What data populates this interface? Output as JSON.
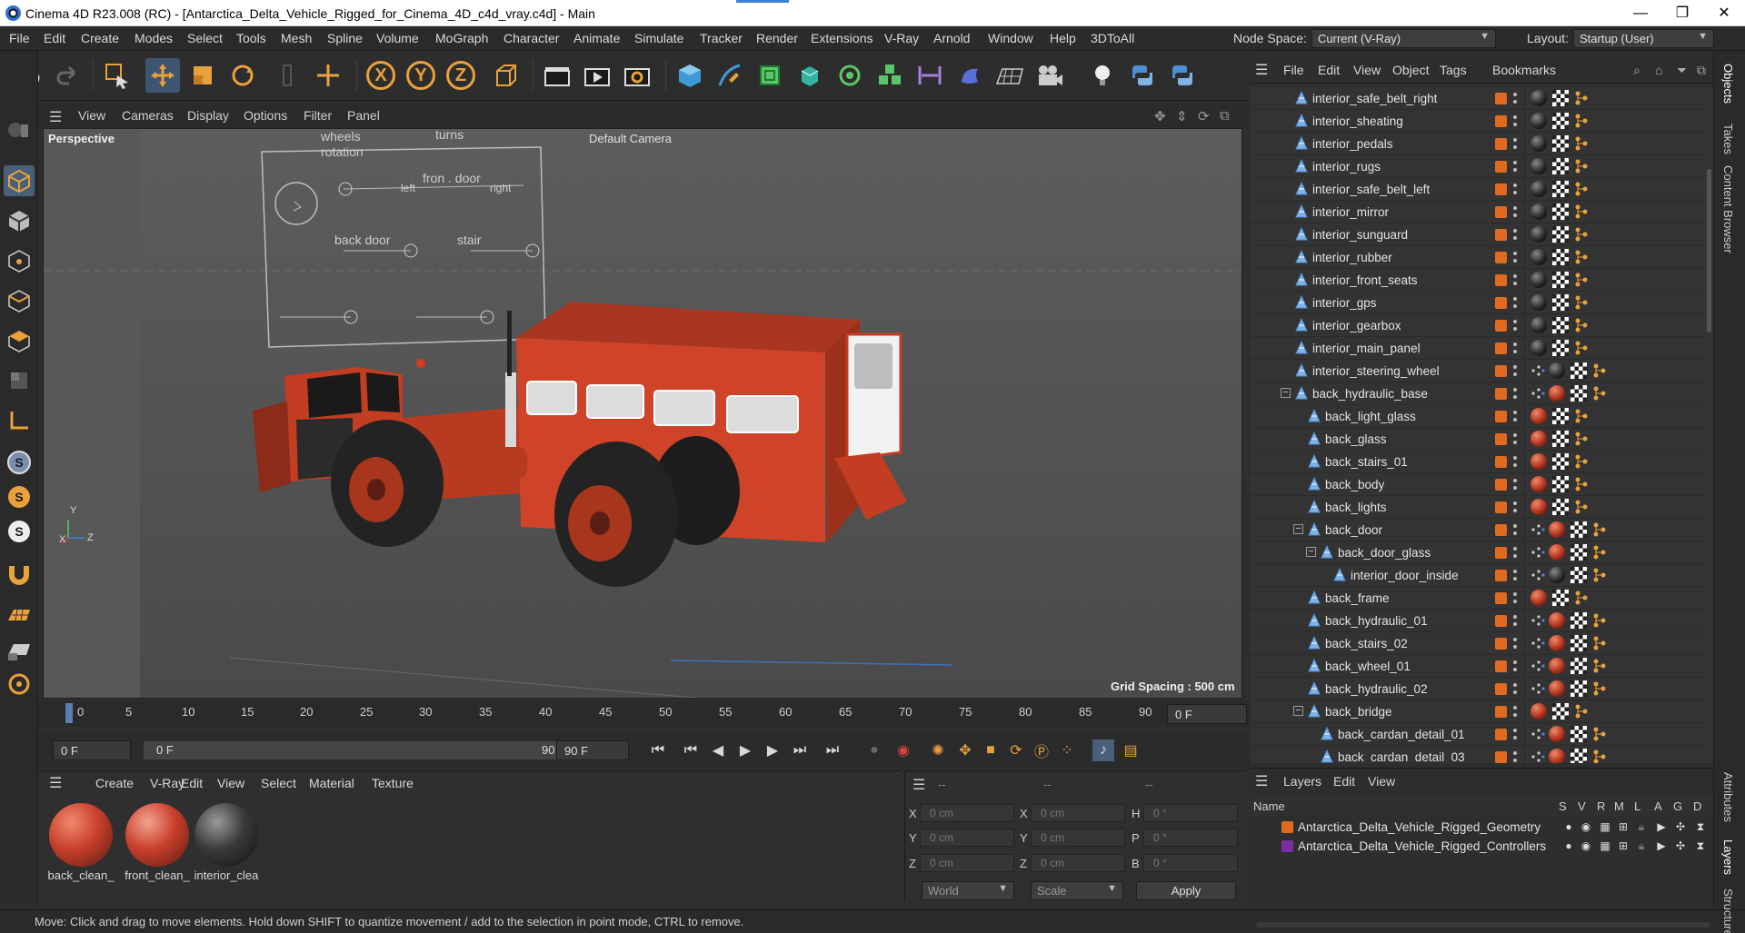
{
  "titlebar": {
    "title": "Cinema 4D R23.008 (RC) - [Antarctica_Delta_Vehicle_Rigged_for_Cinema_4D_c4d_vray.c4d] - Main",
    "minimize": "—",
    "maximize": "❐",
    "close": "✕"
  },
  "menu": {
    "items": [
      "File",
      "Edit",
      "Create",
      "Modes",
      "Select",
      "Tools",
      "Mesh",
      "Spline",
      "Volume",
      "MoGraph",
      "Character",
      "Animate",
      "Simulate",
      "Tracker",
      "Render",
      "Extensions",
      "V-Ray",
      "Arnold",
      "Window",
      "Help",
      "3DToAll"
    ],
    "node_space_label": "Node Space:",
    "node_space_value": "Current (V-Ray)",
    "layout_label": "Layout:",
    "layout_value": "Startup (User)"
  },
  "viewport": {
    "menu": [
      "View",
      "Cameras",
      "Display",
      "Options",
      "Filter",
      "Panel"
    ],
    "label": "Perspective",
    "camera": "Default Camera",
    "grid_spacing": "Grid Spacing : 500 cm",
    "control_panel": {
      "wheels_rotation": "wheels\nrotation",
      "turns": "turns",
      "front_door": "fron . door",
      "left": "left",
      "right": "right",
      "back_door": "back door",
      "stair": "stair"
    },
    "axis_x": "X",
    "axis_y": "Y",
    "axis_z": "Z"
  },
  "timeline": {
    "ticks": [
      "0",
      "5",
      "10",
      "15",
      "20",
      "25",
      "30",
      "35",
      "40",
      "45",
      "50",
      "55",
      "60",
      "65",
      "70",
      "75",
      "80",
      "85",
      "90"
    ],
    "current_frame": "0 F"
  },
  "transport": {
    "start_field": "0 F",
    "range_start": "0 F",
    "range_end": "90 F",
    "end_field": "90 F"
  },
  "materials": {
    "menu": [
      "Create",
      "V-Ray",
      "Edit",
      "View",
      "Select",
      "Material",
      "Texture"
    ],
    "items": [
      {
        "label": "back_clean_",
        "color": "#c9402c"
      },
      {
        "label": "front_clean_",
        "color": "#c9402c"
      },
      {
        "label": "interior_clea",
        "color": "#3a3a3a"
      }
    ]
  },
  "coords": {
    "header": [
      "--",
      "--",
      "--"
    ],
    "rows": [
      {
        "a": "X",
        "av": "0 cm",
        "b": "X",
        "bv": "0 cm",
        "c": "H",
        "cv": "0 °"
      },
      {
        "a": "Y",
        "av": "0 cm",
        "b": "Y",
        "bv": "0 cm",
        "c": "P",
        "cv": "0 °"
      },
      {
        "a": "Z",
        "av": "0 cm",
        "b": "Z",
        "bv": "0 cm",
        "c": "B",
        "cv": "0 °"
      }
    ],
    "mode1": "World",
    "mode2": "Scale",
    "apply": "Apply"
  },
  "status": "Move: Click and drag to move elements. Hold down SHIFT to quantize movement / add to the selection in point mode, CTRL to remove.",
  "objects": {
    "menu": [
      "File",
      "Edit",
      "View",
      "Object",
      "Tags",
      "Bookmarks"
    ],
    "rows": [
      {
        "name": "interior_safe_belt_right",
        "level": 1
      },
      {
        "name": "interior_sheating",
        "level": 1
      },
      {
        "name": "interior_pedals",
        "level": 1
      },
      {
        "name": "interior_rugs",
        "level": 1
      },
      {
        "name": "interior_safe_belt_left",
        "level": 1
      },
      {
        "name": "interior_mirror",
        "level": 1
      },
      {
        "name": "interior_sunguard",
        "level": 1
      },
      {
        "name": "interior_rubber",
        "level": 1
      },
      {
        "name": "interior_front_seats",
        "level": 1
      },
      {
        "name": "interior_gps",
        "level": 1
      },
      {
        "name": "interior_gearbox",
        "level": 1
      },
      {
        "name": "interior_main_panel",
        "level": 1
      },
      {
        "name": "interior_steering_wheel",
        "level": 1
      },
      {
        "name": "back_hydraulic_base",
        "level": 1
      },
      {
        "name": "back_light_glass",
        "level": 2
      },
      {
        "name": "back_glass",
        "level": 2
      },
      {
        "name": "back_stairs_01",
        "level": 2
      },
      {
        "name": "back_body",
        "level": 2
      },
      {
        "name": "back_lights",
        "level": 2
      },
      {
        "name": "back_door",
        "level": 2
      },
      {
        "name": "back_door_glass",
        "level": 3
      },
      {
        "name": "interior_door_inside",
        "level": 4
      },
      {
        "name": "back_frame",
        "level": 2
      },
      {
        "name": "back_hydraulic_01",
        "level": 2
      },
      {
        "name": "back_stairs_02",
        "level": 2
      },
      {
        "name": "back_wheel_01",
        "level": 2
      },
      {
        "name": "back_hydraulic_02",
        "level": 2
      },
      {
        "name": "back_bridge",
        "level": 2
      },
      {
        "name": "back_cardan_detail_01",
        "level": 3
      },
      {
        "name": "back_cardan_detail_03",
        "level": 3
      }
    ]
  },
  "layers": {
    "menu": [
      "Layers",
      "Edit",
      "View"
    ],
    "columns": [
      "Name",
      "S",
      "V",
      "R",
      "M",
      "L",
      "A",
      "G",
      "D"
    ],
    "rows": [
      {
        "name": "Antarctica_Delta_Vehicle_Rigged_Geometry",
        "color": "#e06b20"
      },
      {
        "name": "Antarctica_Delta_Vehicle_Rigged_Controllers",
        "color": "#7a2ea0"
      }
    ]
  },
  "right_tabs": [
    "Objects",
    "Takes",
    "Content Browser",
    "Attributes",
    "Layers",
    "Structure"
  ]
}
